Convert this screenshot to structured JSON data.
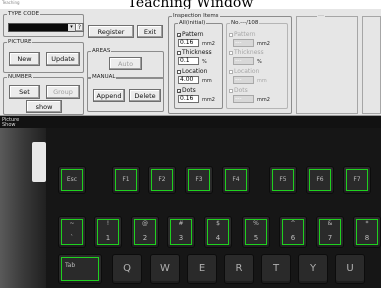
{
  "window": {
    "title": "Teaching Window",
    "mini_title": "Teaching"
  },
  "type_code": {
    "legend": "TYPE CODE",
    "value": "",
    "help_label": "?"
  },
  "header_buttons": {
    "register": "Register",
    "exit": "Exit"
  },
  "picture": {
    "legend": "PICTURE",
    "new": "New",
    "update": "Update"
  },
  "areas": {
    "legend": "AREAS",
    "auto": "Auto"
  },
  "number": {
    "legend": "NUMBER",
    "set": "Set",
    "group": "Group",
    "show": "show"
  },
  "manual": {
    "legend": "MANUAL",
    "append": "Append",
    "delete": "Delete"
  },
  "inspection": {
    "legend": "Inspection Items",
    "all_header": "All(initial)",
    "no_header": "No.---/108",
    "items": [
      {
        "label": "Pattern",
        "checked": true,
        "value": "0.16",
        "unit": "mm2"
      },
      {
        "label": "Thickness",
        "checked": false,
        "value": "0.1",
        "unit": "%"
      },
      {
        "label": "Location",
        "checked": false,
        "value": "4.00",
        "unit": "mm"
      },
      {
        "label": "Dots",
        "checked": true,
        "value": "0.16",
        "unit": "mm2"
      }
    ],
    "right_items": [
      {
        "label": "Pattern",
        "value": "---",
        "unit": "mm2"
      },
      {
        "label": "Thickness",
        "value": "---",
        "unit": "%"
      },
      {
        "label": "Location",
        "value": "---",
        "unit": "mm"
      },
      {
        "label": "Dots",
        "value": "---",
        "unit": "mm2"
      }
    ]
  },
  "right_panel": {
    "label": "---"
  },
  "tabs": {
    "picture_tab": "Picture",
    "show_tab": "Show"
  },
  "keyboard": {
    "row_function": [
      "Esc",
      "F1",
      "F2",
      "F3",
      "F4",
      "F5",
      "F6",
      "F7"
    ],
    "row_number": [
      {
        "top": "~",
        "bottom": "`"
      },
      {
        "top": "!",
        "bottom": "1"
      },
      {
        "top": "@",
        "bottom": "2"
      },
      {
        "top": "#",
        "bottom": "3"
      },
      {
        "top": "$",
        "bottom": "4"
      },
      {
        "top": "%",
        "bottom": "5"
      },
      {
        "top": "^",
        "bottom": "6"
      },
      {
        "top": "&",
        "bottom": "7"
      },
      {
        "top": "*",
        "bottom": "8"
      }
    ],
    "row_letters": [
      "Tab",
      "Q",
      "W",
      "E",
      "R",
      "T",
      "Y",
      "U"
    ],
    "roi_color": "#1fd11f"
  }
}
